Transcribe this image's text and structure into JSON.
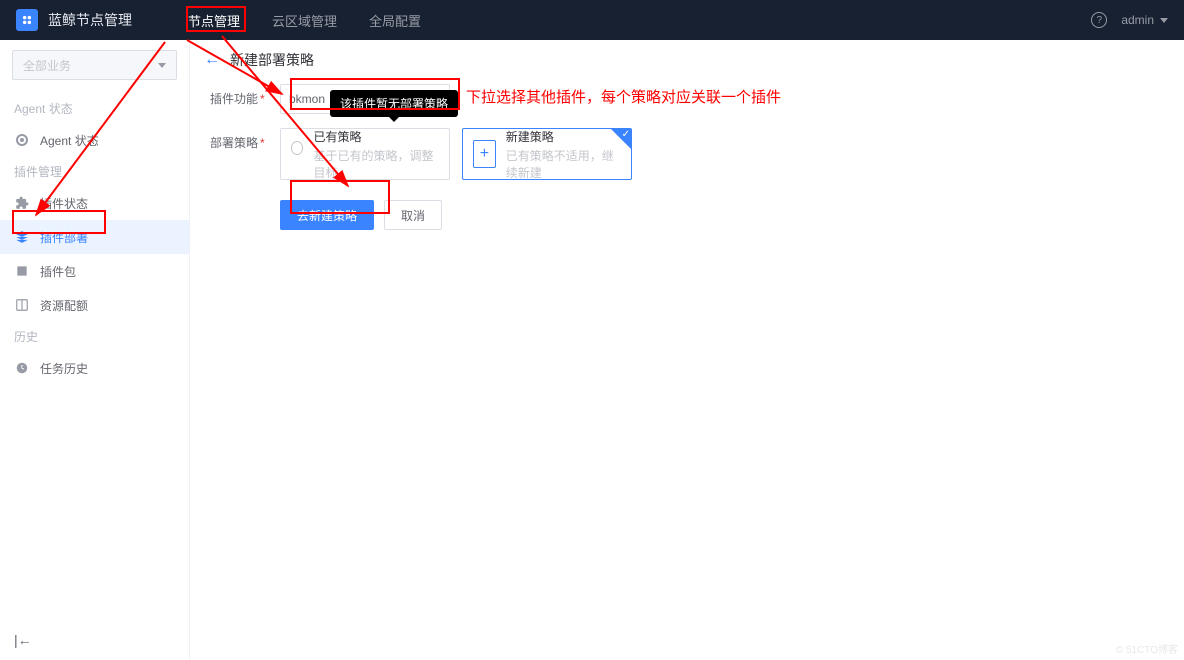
{
  "header": {
    "brand": "蓝鲸节点管理",
    "nav": [
      "节点管理",
      "云区域管理",
      "全局配置"
    ],
    "nav_active": 0,
    "user": "admin"
  },
  "sidebar": {
    "biz_placeholder": "全部业务",
    "groups": [
      {
        "title": "Agent 状态",
        "items": [
          {
            "label": "Agent 状态",
            "icon": "radio"
          }
        ]
      },
      {
        "title": "插件管理",
        "items": [
          {
            "label": "插件状态",
            "icon": "puzzle"
          },
          {
            "label": "插件部署",
            "icon": "deploy",
            "active": true
          },
          {
            "label": "插件包",
            "icon": "package"
          },
          {
            "label": "资源配额",
            "icon": "quota"
          }
        ]
      },
      {
        "title": "历史",
        "items": [
          {
            "label": "任务历史",
            "icon": "clock"
          }
        ]
      }
    ]
  },
  "page": {
    "title": "新建部署策略",
    "form": {
      "plugin_label": "插件功能",
      "plugin_value": "bkmonitorbeat(蓝鲸监控指标采集器)",
      "plugin_short": "bkmon",
      "strategy_label": "部署策略",
      "existing_card": {
        "title": "已有策略",
        "desc": "基于已有的策略，调整目标"
      },
      "new_card": {
        "title": "新建策略",
        "desc": "已有策略不适用，继续新建"
      }
    },
    "tooltip": "该插件暂无部署策略",
    "actions": {
      "primary": "去新建策略",
      "cancel": "取消"
    }
  },
  "annotation": {
    "hint": "下拉选择其他插件，每个策略对应关联一个插件"
  },
  "watermark": "© 51CTO博客"
}
